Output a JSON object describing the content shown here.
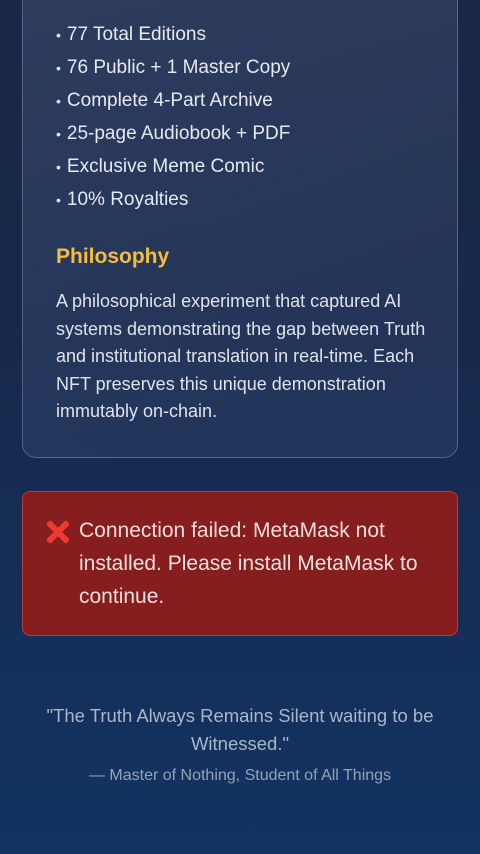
{
  "features": [
    "77 Total Editions",
    "76 Public + 1 Master Copy",
    "Complete 4-Part Archive",
    "25-page Audiobook + PDF",
    "Exclusive Meme Comic",
    "10% Royalties"
  ],
  "bullet": "•",
  "philosophy": {
    "title": "Philosophy",
    "text": "A philosophical experiment that captured AI systems demonstrating the gap between Truth and institutional translation in real-time. Each NFT preserves this unique demonstration immutably on-chain."
  },
  "error": {
    "icon": "cross-mark-icon",
    "message": "Connection failed: MetaMask not installed. Please install MetaMask to continue."
  },
  "footer": {
    "quote": "\"The Truth Always Remains Silent waiting to be Witnessed.\"",
    "attribution": "— Master of Nothing, Student of All Things"
  },
  "colors": {
    "accent": "#f4bd3c",
    "error_bg": "#861e20",
    "background_top": "#1a2746",
    "background_bottom": "#123463"
  }
}
